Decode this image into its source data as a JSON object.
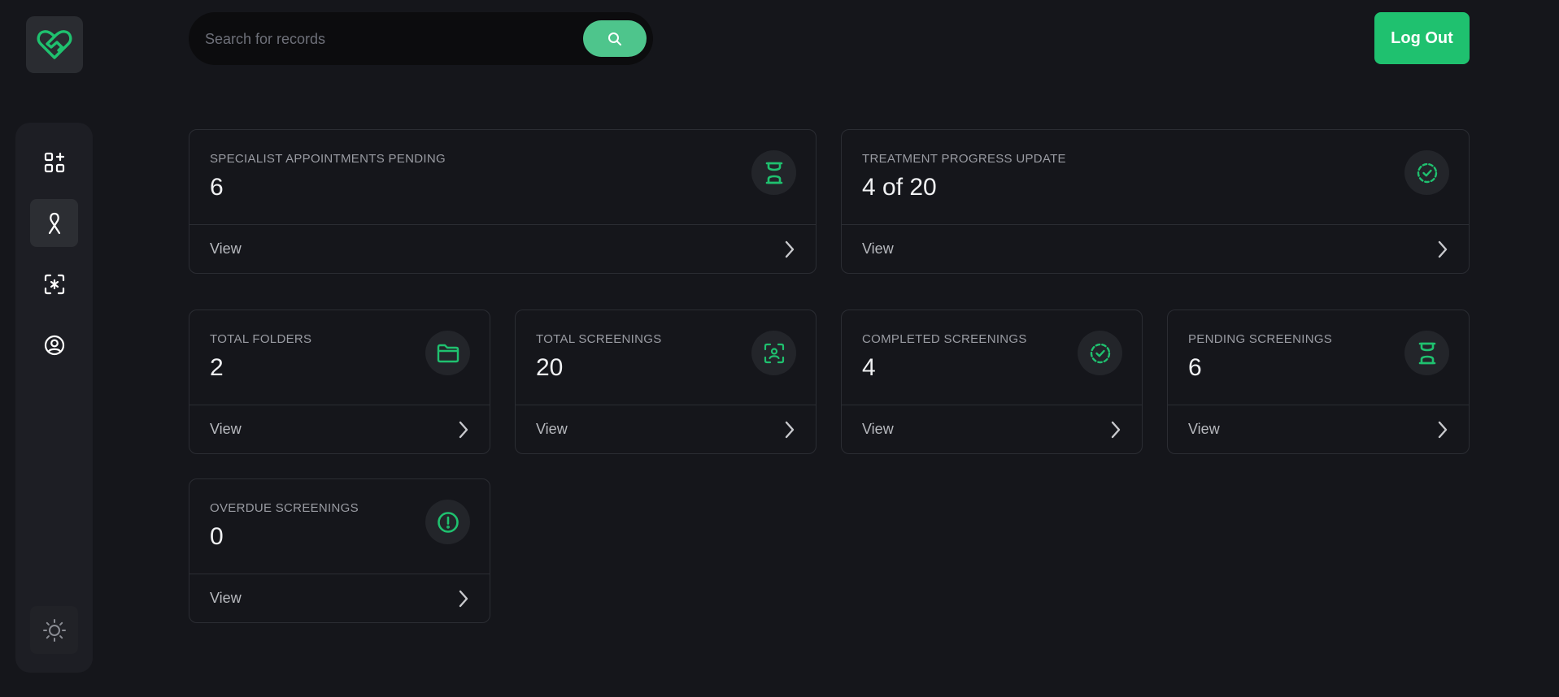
{
  "search": {
    "placeholder": "Search for records"
  },
  "header": {
    "logout_label": "Log Out"
  },
  "sidebar": {
    "items": [
      {
        "name": "dashboard",
        "icon": "dashboard-add-icon",
        "active": false
      },
      {
        "name": "ribbon",
        "icon": "ribbon-icon",
        "active": true
      },
      {
        "name": "screening",
        "icon": "screening-scan-icon",
        "active": false
      },
      {
        "name": "profile",
        "icon": "user-circle-icon",
        "active": false
      }
    ],
    "theme_icon": "sun-icon"
  },
  "colors": {
    "accent": "#1fc16f",
    "background": "#15161b",
    "sidebar": "#1d1e24"
  },
  "cards": [
    {
      "label": "SPECIALIST APPOINTMENTS PENDING",
      "value": "6",
      "icon": "hourglass-icon",
      "link": "View"
    },
    {
      "label": "TREATMENT PROGRESS UPDATE",
      "value": "4 of 20",
      "icon": "check-circle-dashed-icon",
      "link": "View"
    },
    {
      "label": "TOTAL FOLDERS",
      "value": "2",
      "icon": "folder-icon",
      "link": "View"
    },
    {
      "label": "TOTAL SCREENINGS",
      "value": "20",
      "icon": "face-scan-icon",
      "link": "View"
    },
    {
      "label": "COMPLETED SCREENINGS",
      "value": "4",
      "icon": "check-circle-dashed-icon",
      "link": "View"
    },
    {
      "label": "PENDING SCREENINGS",
      "value": "6",
      "icon": "hourglass-icon",
      "link": "View"
    },
    {
      "label": "OVERDUE SCREENINGS",
      "value": "0",
      "icon": "alert-circle-icon",
      "link": "View"
    }
  ]
}
